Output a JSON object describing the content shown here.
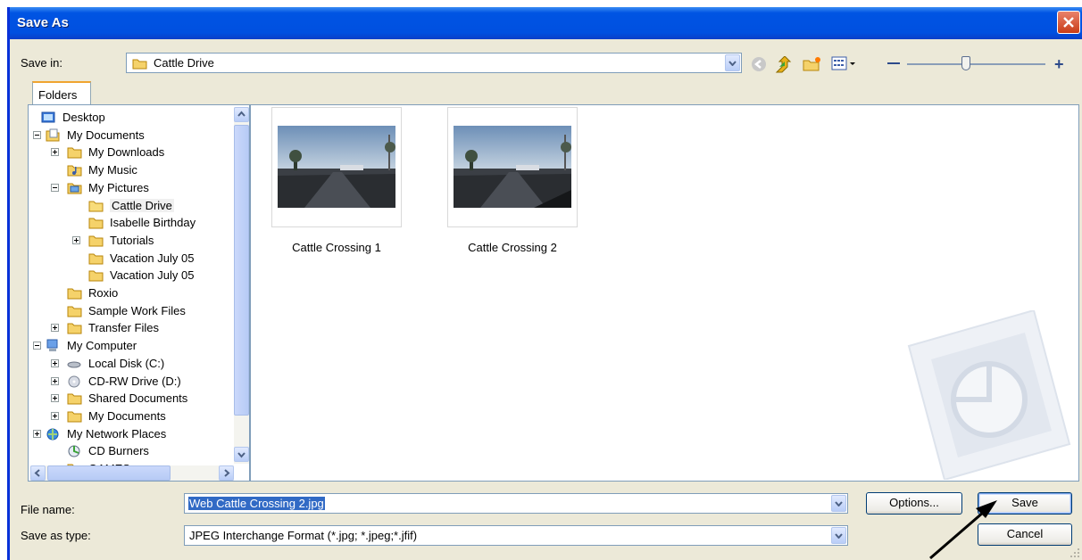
{
  "dialog": {
    "title": "Save As"
  },
  "save_in": {
    "label": "Save in:",
    "value": "Cattle Drive"
  },
  "tabs": {
    "folders": "Folders"
  },
  "tree": [
    {
      "label": "Desktop",
      "icon": "desktop-icon"
    },
    {
      "label": "My Documents",
      "icon": "my-documents-icon",
      "expander": "minus"
    },
    {
      "label": "My Downloads",
      "icon": "folder-icon",
      "expander": "plus"
    },
    {
      "label": "My Music",
      "icon": "my-music-icon"
    },
    {
      "label": "My Pictures",
      "icon": "my-pictures-icon",
      "expander": "minus"
    },
    {
      "label": "Cattle Drive",
      "icon": "folder-open-icon",
      "selected": true
    },
    {
      "label": "Isabelle Birthday",
      "icon": "folder-icon"
    },
    {
      "label": "Tutorials",
      "icon": "folder-icon",
      "expander": "plus"
    },
    {
      "label": "Vacation July 05",
      "icon": "folder-icon"
    },
    {
      "label": "Vacation July 05",
      "icon": "folder-icon"
    },
    {
      "label": "Roxio",
      "icon": "folder-icon"
    },
    {
      "label": "Sample Work Files",
      "icon": "folder-icon"
    },
    {
      "label": "Transfer Files",
      "icon": "folder-icon",
      "expander": "plus"
    },
    {
      "label": "My Computer",
      "icon": "my-computer-icon",
      "expander": "minus"
    },
    {
      "label": "Local Disk (C:)",
      "icon": "hard-drive-icon",
      "expander": "plus"
    },
    {
      "label": "CD-RW Drive (D:)",
      "icon": "cd-drive-icon",
      "expander": "plus"
    },
    {
      "label": "Shared Documents",
      "icon": "folder-icon",
      "expander": "plus"
    },
    {
      "label": "My Documents",
      "icon": "folder-icon",
      "expander": "plus"
    },
    {
      "label": "My Network Places",
      "icon": "network-places-icon",
      "expander": "plus"
    },
    {
      "label": "CD Burners",
      "icon": "cd-burners-icon"
    },
    {
      "label": "GAMES",
      "icon": "folder-icon"
    }
  ],
  "files": [
    {
      "name": "Cattle Crossing 1"
    },
    {
      "name": "Cattle Crossing 2"
    }
  ],
  "file_name": {
    "label": "File name:",
    "value": "Web Cattle Crossing 2.jpg"
  },
  "save_as_type": {
    "label": "Save as type:",
    "value": "JPEG Interchange Format (*.jpg; *.jpeg;*.jfif)"
  },
  "buttons": {
    "options": "Options...",
    "save": "Save",
    "cancel": "Cancel"
  },
  "colors": {
    "titlebar": "#0054e3",
    "dialog_bg": "#ece9d8",
    "selection": "#316ac5",
    "folder": "#f5d26a"
  }
}
